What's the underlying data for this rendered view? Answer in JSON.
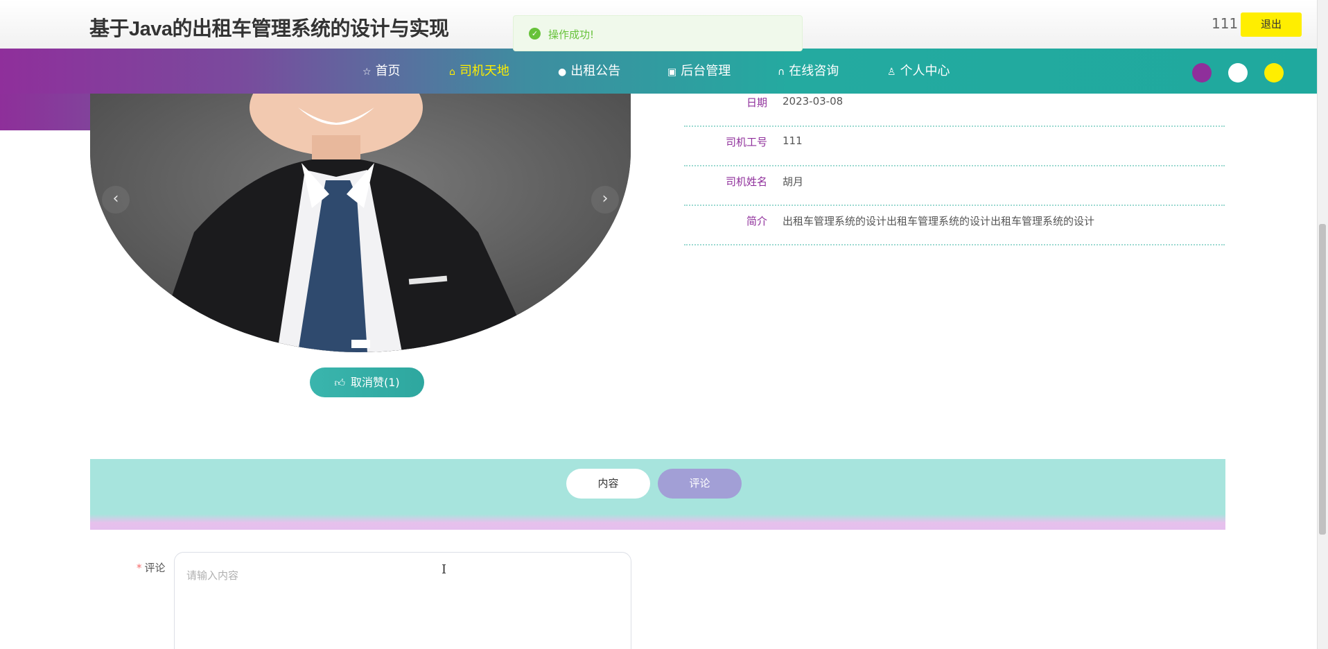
{
  "header": {
    "site_title": "基于Java的出租车管理系统的设计与实现",
    "user_name": "111",
    "logout_label": "退出"
  },
  "toast": {
    "message": "操作成功!",
    "icon": "check-circle-icon",
    "color": "#67c23a"
  },
  "nav": {
    "items": [
      {
        "label": "首页",
        "icon": "star-icon"
      },
      {
        "label": "司机天地",
        "icon": "bag-icon",
        "active": true
      },
      {
        "label": "出租公告",
        "icon": "info-icon"
      },
      {
        "label": "后台管理",
        "icon": "gift-icon"
      },
      {
        "label": "在线咨询",
        "icon": "headset-icon"
      },
      {
        "label": "个人中心",
        "icon": "user-icon"
      }
    ],
    "theme_colors": [
      "#8f2f9b",
      "#ffffff",
      "#ffee00"
    ],
    "active_color": "#ffee00"
  },
  "carousel": {
    "prev_icon": "chevron-left-icon",
    "next_icon": "chevron-right-icon",
    "prev_glyph": "‹",
    "next_glyph": "›"
  },
  "like": {
    "label": "取消赞(1)",
    "icon": "thumbs-up-icon"
  },
  "details": {
    "rows": [
      {
        "label": "日期",
        "value": "2023-03-08"
      },
      {
        "label": "司机工号",
        "value": "111"
      },
      {
        "label": "司机姓名",
        "value": "胡月"
      },
      {
        "label": "简介",
        "value": "出租车管理系统的设计出租车管理系统的设计出租车管理系统的设计"
      }
    ]
  },
  "tabs": {
    "content_label": "内容",
    "comment_label": "评论",
    "active": "评论"
  },
  "comment_form": {
    "label": "评论",
    "required_mark": "*",
    "placeholder": "请输入内容",
    "value": ""
  }
}
